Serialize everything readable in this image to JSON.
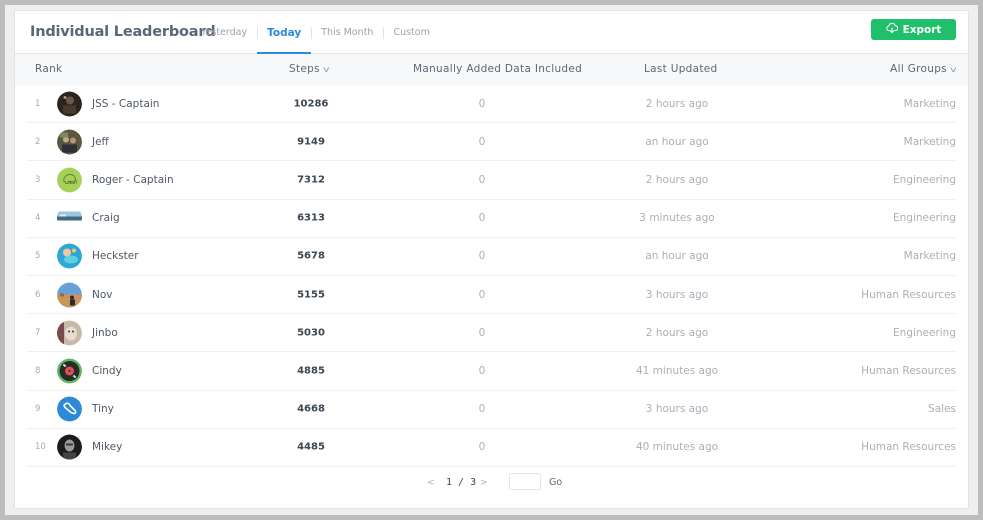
{
  "header": {
    "title": "Individual Leaderboard",
    "tabs": [
      {
        "label": "Yesterday",
        "active": false
      },
      {
        "label": "Today",
        "active": true
      },
      {
        "label": "This Month",
        "active": false
      },
      {
        "label": "Custom",
        "active": false
      }
    ],
    "export_label": "Export",
    "export_icon": "cloud-download-icon"
  },
  "colors": {
    "accent": "#2e8ad8",
    "export_button": "#20bf6b",
    "header_row_bg": "#f6f8fa"
  },
  "table": {
    "columns": {
      "rank": "Rank",
      "steps": "Steps",
      "manual": "Manually Added Data Included",
      "updated": "Last Updated",
      "groups": "All Groups"
    },
    "sort_icon": "chevron-down-icon",
    "rows": [
      {
        "rank": "1",
        "name": "JSS - Captain",
        "steps": "10286",
        "manual": "0",
        "updated": "2 hours ago",
        "group": "Marketing",
        "avatar": "photo-dark"
      },
      {
        "rank": "2",
        "name": "Jeff",
        "steps": "9149",
        "manual": "0",
        "updated": "an hour ago",
        "group": "Marketing",
        "avatar": "photo-group"
      },
      {
        "rank": "3",
        "name": "Roger - Captain",
        "steps": "7312",
        "manual": "0",
        "updated": "2 hours ago",
        "group": "Engineering",
        "avatar": "elephant-green"
      },
      {
        "rank": "4",
        "name": "Craig",
        "steps": "6313",
        "manual": "0",
        "updated": "3 minutes ago",
        "group": "Engineering",
        "avatar": "photo-harbor"
      },
      {
        "rank": "5",
        "name": "Heckster",
        "steps": "5678",
        "manual": "0",
        "updated": "an hour ago",
        "group": "Marketing",
        "avatar": "photo-pool"
      },
      {
        "rank": "6",
        "name": "Nov",
        "steps": "5155",
        "manual": "0",
        "updated": "3 hours ago",
        "group": "Human Resources",
        "avatar": "photo-desert"
      },
      {
        "rank": "7",
        "name": "Jinbo",
        "steps": "5030",
        "manual": "0",
        "updated": "2 hours ago",
        "group": "Engineering",
        "avatar": "photo-cat"
      },
      {
        "rank": "8",
        "name": "Cindy",
        "steps": "4885",
        "manual": "0",
        "updated": "41 minutes ago",
        "group": "Human Resources",
        "avatar": "record-green"
      },
      {
        "rank": "9",
        "name": "Tiny",
        "steps": "4668",
        "manual": "0",
        "updated": "3 hours ago",
        "group": "Sales",
        "avatar": "shoe-blue"
      },
      {
        "rank": "10",
        "name": "Mikey",
        "steps": "4485",
        "manual": "0",
        "updated": "40 minutes ago",
        "group": "Human Resources",
        "avatar": "photo-bw"
      }
    ]
  },
  "pagination": {
    "prev": "<",
    "page_text": "1 / 3",
    "next": ">",
    "input_value": "",
    "go_label": "Go"
  }
}
